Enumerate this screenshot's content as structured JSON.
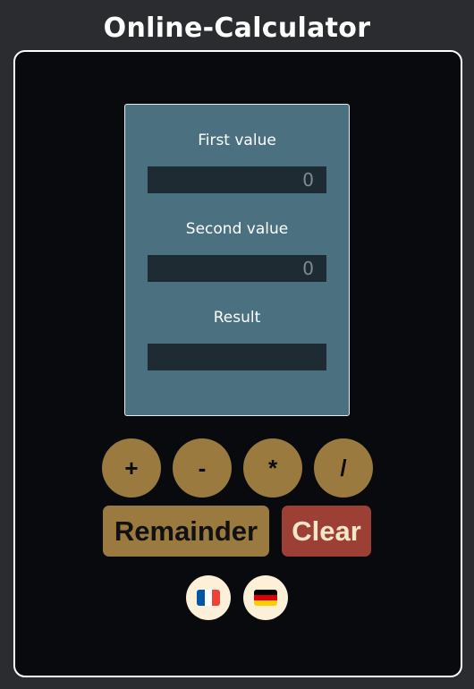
{
  "header": {
    "title": "Online-Calculator"
  },
  "form": {
    "first_value": {
      "label": "First value",
      "placeholder": "0",
      "value": ""
    },
    "second_value": {
      "label": "Second value",
      "placeholder": "0",
      "value": ""
    },
    "result": {
      "label": "Result",
      "value": ""
    }
  },
  "operations": {
    "add": "+",
    "subtract": "-",
    "multiply": "*",
    "divide": "/"
  },
  "actions": {
    "remainder": "Remainder",
    "clear": "Clear"
  },
  "languages": [
    {
      "icon": "french-flag-icon",
      "colors": [
        "#0055a4",
        "#ffffff",
        "#ef4135"
      ]
    },
    {
      "icon": "german-flag-icon",
      "colors": [
        "#000000",
        "#dd0000",
        "#ffce00"
      ]
    }
  ],
  "colors": {
    "background": "#2b2c2f",
    "card": "#080a0e",
    "panel": "#4b7080",
    "input": "#1f2b33",
    "operation_button": "#9b7a3f",
    "clear_button": "#9c4036",
    "language_button": "#fdf0d8"
  }
}
